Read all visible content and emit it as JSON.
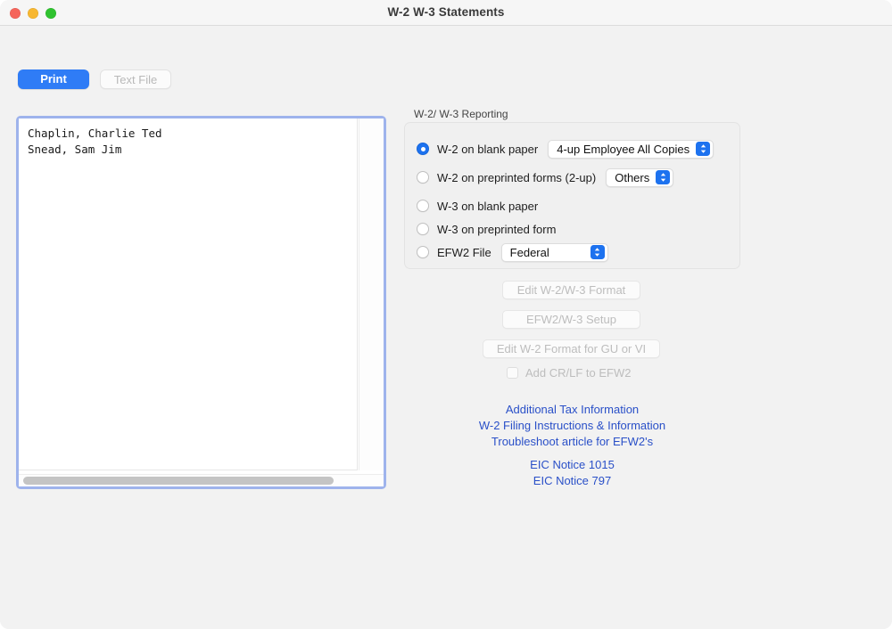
{
  "window": {
    "title": "W-2 W-3 Statements",
    "traffic_lights": [
      "close-button",
      "minimize-button",
      "maximize-button"
    ]
  },
  "toolbar": {
    "print_label": "Print",
    "text_file_label": "Text File"
  },
  "employee_list": {
    "rows": [
      "Chaplin, Charlie Ted",
      "Snead, Sam Jim"
    ]
  },
  "reporting": {
    "group_label": "W-2/ W-3 Reporting",
    "options": [
      {
        "label": "W-2 on blank paper",
        "selected": true,
        "dropdown": "4-up Employee All Copies"
      },
      {
        "label": "W-2 on preprinted forms (2-up)",
        "selected": false,
        "dropdown": "Others"
      },
      {
        "label": "W-3 on blank paper",
        "selected": false,
        "dropdown": null
      },
      {
        "label": "W-3 on preprinted form",
        "selected": false,
        "dropdown": null
      },
      {
        "label": "EFW2 File",
        "selected": false,
        "dropdown": "Federal"
      }
    ]
  },
  "actions": {
    "edit_format_label": "Edit W-2/W-3 Format",
    "efw2_setup_label": "EFW2/W-3 Setup",
    "edit_gu_vi_label": "Edit W-2 Format for GU or VI",
    "add_crlf_label": "Add CR/LF to EFW2",
    "add_crlf_checked": false
  },
  "links": [
    "Additional Tax Information",
    "W-2 Filing Instructions & Information",
    "Troubleshoot article for EFW2's",
    "EIC Notice 1015",
    "EIC Notice 797"
  ],
  "colors": {
    "accent_blue": "#2f7cf6",
    "control_blue": "#1d72ef",
    "focus_ring": "#9eb3ec",
    "link_blue": "#2a50c8",
    "window_bg": "#f2f2f2"
  }
}
